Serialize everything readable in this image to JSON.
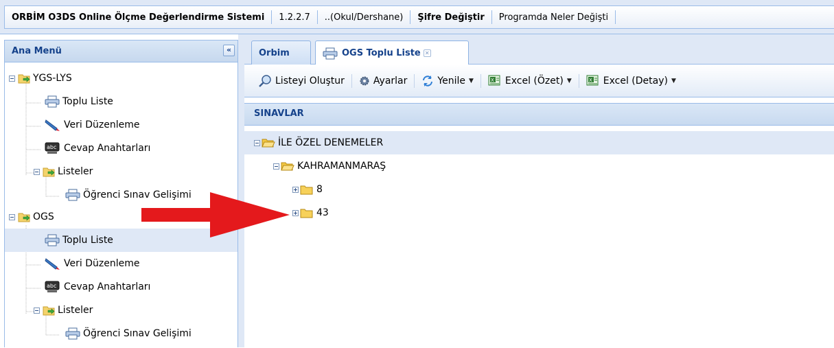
{
  "topbar": {
    "app_title": "ORBİM O3DS Online Ölçme Değerlendirme Sistemi",
    "version": "1.2.2.7",
    "school": "..(Okul/Dershane)",
    "change_password": "Şifre Değiştir",
    "whats_new": "Programda Neler Değişti"
  },
  "left_panel": {
    "title": "Ana Menü",
    "collapse_icon": "double-chevron-left",
    "items": [
      {
        "label": "YGS-LYS",
        "icon": "folder-go-icon"
      },
      {
        "label": "Toplu Liste",
        "icon": "printer-icon"
      },
      {
        "label": "Veri Düzenleme",
        "icon": "pencil-icon"
      },
      {
        "label": "Cevap Anahtarları",
        "icon": "spellcheck-icon"
      },
      {
        "label": "Listeler",
        "icon": "folder-go-icon"
      },
      {
        "label": "Öğrenci Sınav Gelişimi",
        "icon": "printer-icon"
      },
      {
        "label": "OGS",
        "icon": "folder-go-icon"
      },
      {
        "label": "Toplu Liste",
        "icon": "printer-icon",
        "selected": true
      },
      {
        "label": "Veri Düzenleme",
        "icon": "pencil-icon"
      },
      {
        "label": "Cevap Anahtarları",
        "icon": "spellcheck-icon"
      },
      {
        "label": "Listeler",
        "icon": "folder-go-icon"
      },
      {
        "label": "Öğrenci Sınav Gelişimi",
        "icon": "printer-icon"
      }
    ]
  },
  "tabs": [
    {
      "label": "Orbim",
      "active": false
    },
    {
      "label": "OGS Toplu Liste",
      "active": true,
      "icon": "printer-icon",
      "closable": true
    }
  ],
  "toolbar": {
    "create_list": "Listeyi Oluştur",
    "settings": "Ayarlar",
    "refresh": "Yenile",
    "excel_summary": "Excel (Özet)",
    "excel_detail": "Excel (Detay)"
  },
  "section": {
    "title": "SINAVLAR"
  },
  "exam_tree": [
    {
      "label": "İLE ÖZEL DENEMELER",
      "expanded": true,
      "selected": true
    },
    {
      "label": "KAHRAMANMARAŞ",
      "expanded": true
    },
    {
      "label": "8",
      "expanded": false
    },
    {
      "label": "43",
      "expanded": false
    }
  ],
  "colors": {
    "header_bg": "#dfe8f6",
    "border": "#99bbe8",
    "title_text": "#15428b",
    "folder_yellow": "#f7d15a",
    "annotation_arrow": "#e4191c"
  }
}
